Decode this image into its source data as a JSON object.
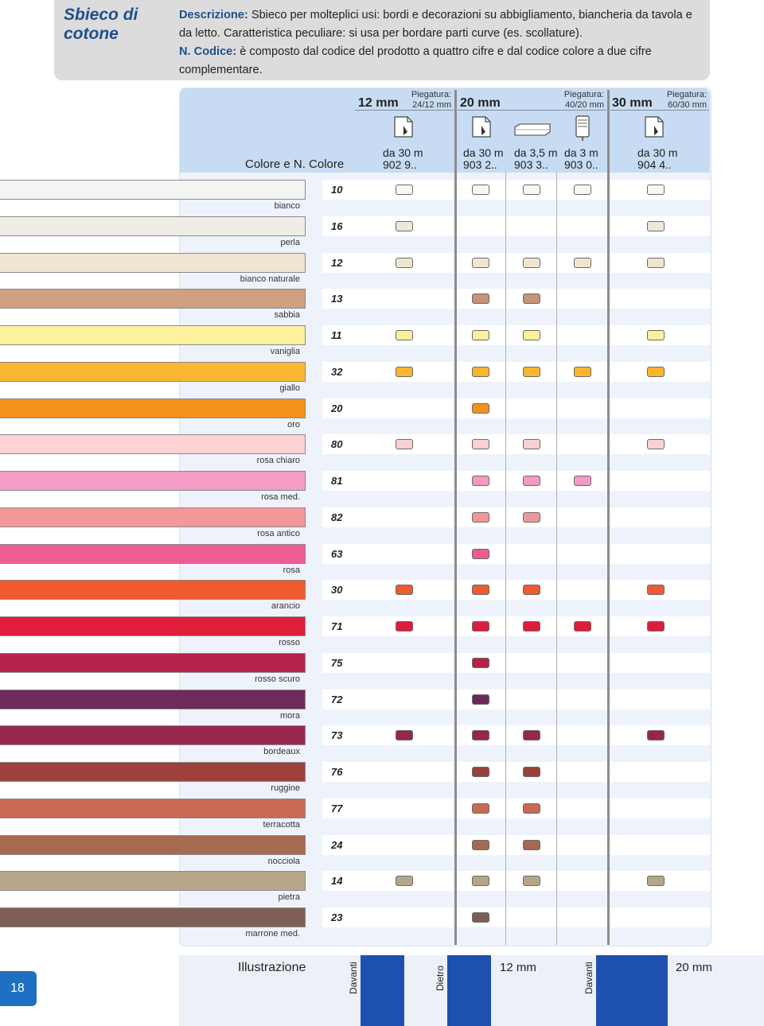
{
  "header": {
    "title": "Sbieco di cotone",
    "desc_label": "Descrizione:",
    "desc_text": " Sbieco per molteplici usi: bordi e decorazioni su abbigliamento, biancheria da tavola e da letto. Caratteristica peculiare: si usa per bordare parti curve (es. scollature).",
    "code_label": "N. Codice:",
    "code_text": " è composto dal codice del prodotto a quattro cifre e dal codice colore a due cifre complementare."
  },
  "table_header": {
    "colore_label": "Colore e N. Colore",
    "groups": [
      {
        "size": "12 mm",
        "fold": "Piegatura:\n24/12 mm"
      },
      {
        "size": "20 mm",
        "fold": "Piegatura:\n40/20 mm"
      },
      {
        "size": "30 mm",
        "fold": "Piegatura:\n60/30 mm"
      }
    ],
    "columns": [
      {
        "length": "da 30 m",
        "code": "902 9.."
      },
      {
        "length": "da 30 m",
        "code": "903 2.."
      },
      {
        "length": "da 3,5 m",
        "code": "903 3.."
      },
      {
        "length": "da 3 m",
        "code": "903 0.."
      },
      {
        "length": "da 30 m",
        "code": "904 4.."
      }
    ]
  },
  "rows": [
    {
      "code": "10",
      "name": "bianco",
      "color": "#f4f4f2",
      "chip": "#f7f7f5",
      "avail": [
        1,
        1,
        1,
        1,
        1
      ]
    },
    {
      "code": "16",
      "name": "perla",
      "color": "#efede5",
      "chip": "#ebe8dc",
      "avail": [
        1,
        0,
        0,
        0,
        1
      ]
    },
    {
      "code": "12",
      "name": "bianco naturale",
      "color": "#efe6d1",
      "chip": "#efe5cf",
      "avail": [
        1,
        1,
        1,
        1,
        1
      ]
    },
    {
      "code": "13",
      "name": "sabbia",
      "color": "#cfa081",
      "chip": "#c29478",
      "avail": [
        0,
        1,
        1,
        0,
        0
      ]
    },
    {
      "code": "11",
      "name": "vaniglia",
      "color": "#fdf29e",
      "chip": "#fcf199",
      "avail": [
        1,
        1,
        1,
        0,
        1
      ]
    },
    {
      "code": "32",
      "name": "giallo",
      "color": "#fbb732",
      "chip": "#f9b530",
      "avail": [
        1,
        1,
        1,
        1,
        1
      ]
    },
    {
      "code": "20",
      "name": "oro",
      "color": "#f4921d",
      "chip": "#f29020",
      "avail": [
        0,
        1,
        0,
        0,
        0
      ]
    },
    {
      "code": "80",
      "name": "rosa chiaro",
      "color": "#fdd2d4",
      "chip": "#fbd0d2",
      "avail": [
        1,
        1,
        1,
        0,
        1
      ]
    },
    {
      "code": "81",
      "name": "rosa med.",
      "color": "#f49bc6",
      "chip": "#f39ac4",
      "avail": [
        0,
        1,
        1,
        1,
        0
      ]
    },
    {
      "code": "82",
      "name": "rosa antico",
      "color": "#f29898",
      "chip": "#ef9797",
      "avail": [
        0,
        1,
        1,
        0,
        0
      ]
    },
    {
      "code": "63",
      "name": "rosa",
      "color": "#ee5d94",
      "chip": "#ec5c92",
      "avail": [
        0,
        1,
        0,
        0,
        0
      ]
    },
    {
      "code": "30",
      "name": "arancio",
      "color": "#f15a2f",
      "chip": "#ef5a2f",
      "avail": [
        1,
        1,
        1,
        0,
        1
      ]
    },
    {
      "code": "71",
      "name": "rosso",
      "color": "#e01e3c",
      "chip": "#dc1e3c",
      "avail": [
        1,
        1,
        1,
        1,
        1
      ]
    },
    {
      "code": "75",
      "name": "rosso scuro",
      "color": "#b5234a",
      "chip": "#b32348",
      "avail": [
        0,
        1,
        0,
        0,
        0
      ]
    },
    {
      "code": "72",
      "name": "mora",
      "color": "#6d2a5a",
      "chip": "#6b2a58",
      "avail": [
        0,
        1,
        0,
        0,
        0
      ]
    },
    {
      "code": "73",
      "name": "bordeaux",
      "color": "#98274d",
      "chip": "#96274b",
      "avail": [
        1,
        1,
        1,
        0,
        1
      ]
    },
    {
      "code": "76",
      "name": "ruggine",
      "color": "#9e413c",
      "chip": "#9b403b",
      "avail": [
        0,
        1,
        1,
        0,
        0
      ]
    },
    {
      "code": "77",
      "name": "terracotta",
      "color": "#c96b55",
      "chip": "#c76a54",
      "avail": [
        0,
        1,
        1,
        0,
        0
      ]
    },
    {
      "code": "24",
      "name": "nocciola",
      "color": "#a66a50",
      "chip": "#a46950",
      "avail": [
        0,
        1,
        1,
        0,
        0
      ]
    },
    {
      "code": "14",
      "name": "pietra",
      "color": "#b8a78a",
      "chip": "#b6a688",
      "avail": [
        1,
        1,
        1,
        0,
        1
      ]
    },
    {
      "code": "23",
      "name": "marrone med.",
      "color": "#7e5e55",
      "chip": "#7c5d54",
      "avail": [
        0,
        1,
        0,
        0,
        0
      ]
    }
  ],
  "footer": {
    "page_number": "18",
    "illustrazione": "Illustrazione",
    "davanti": "Davanti",
    "dietro": "Dietro",
    "size_12": "12 mm",
    "size_20": "20 mm",
    "ribbon_color": "#1e50b0"
  }
}
